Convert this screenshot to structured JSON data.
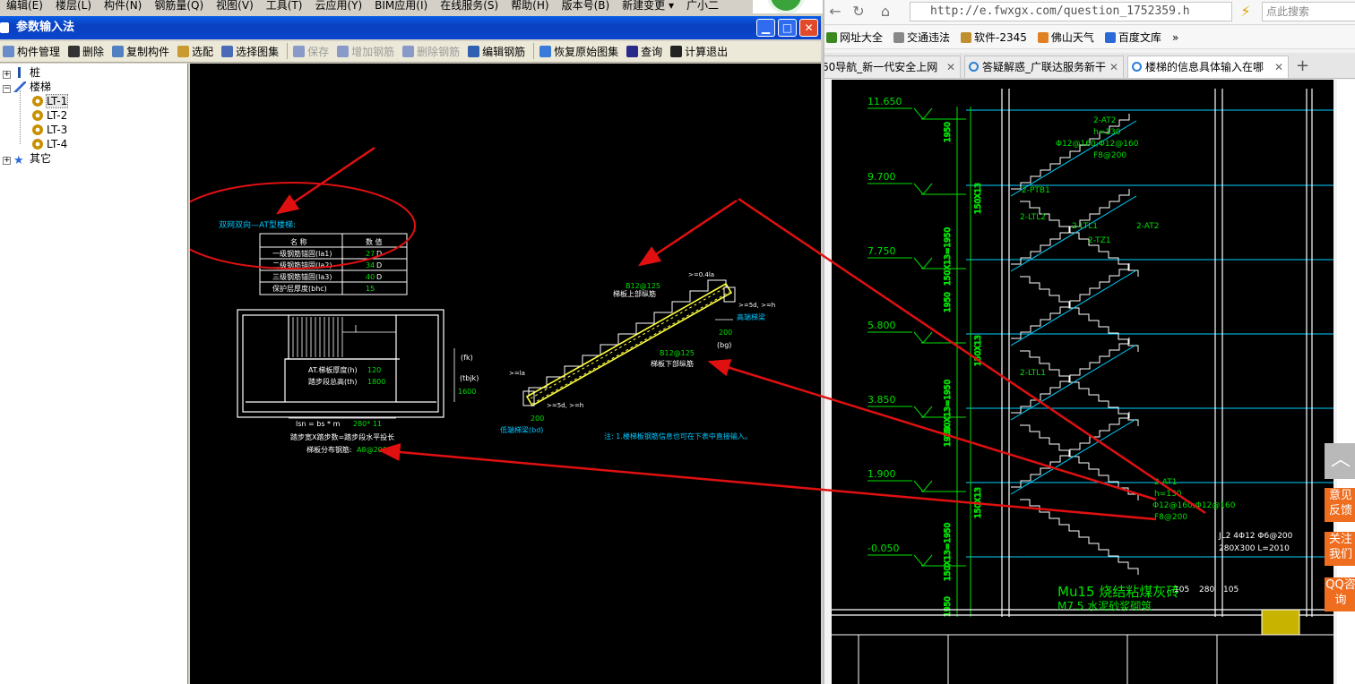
{
  "menubar": {
    "items": [
      "编辑(E)",
      "楼层(L)",
      "构件(N)",
      "钢筋量(Q)",
      "视图(V)",
      "工具(T)",
      "云应用(Y)",
      "BIM应用(I)",
      "在线服务(S)",
      "帮助(H)",
      "版本号(B)",
      "新建变更 ▾",
      "广小二"
    ]
  },
  "dialog": {
    "title": "参数输入法",
    "toolbar": [
      {
        "label": "构件管理",
        "enabled": true,
        "icon": "component-manager-icon"
      },
      {
        "label": "删除",
        "enabled": true,
        "icon": "delete-x-icon"
      },
      {
        "label": "复制构件",
        "enabled": true,
        "icon": "copy-icon"
      },
      {
        "label": "选配",
        "enabled": true,
        "icon": "select-icon"
      },
      {
        "label": "选择图集",
        "enabled": true,
        "icon": "atlas-icon"
      },
      {
        "label": "保存",
        "enabled": false,
        "icon": "save-icon"
      },
      {
        "label": "增加钢筋",
        "enabled": false,
        "icon": "add-rebar-icon"
      },
      {
        "label": "删除钢筋",
        "enabled": false,
        "icon": "delete-rebar-icon"
      },
      {
        "label": "编辑钢筋",
        "enabled": true,
        "icon": "edit-rebar-icon"
      },
      {
        "label": "恢复原始图集",
        "enabled": true,
        "icon": "restore-icon"
      },
      {
        "label": "查询",
        "enabled": true,
        "icon": "query-icon"
      },
      {
        "label": "计算退出",
        "enabled": true,
        "icon": "fx-icon"
      }
    ],
    "tree": {
      "pile": "桩",
      "stairs": "楼梯",
      "stair_items": [
        "LT-1",
        "LT-2",
        "LT-3",
        "LT-4"
      ],
      "selected": "LT-1",
      "other": "其它"
    },
    "cad": {
      "heading": "双网双向—AT型楼梯:",
      "table_head": [
        "名  称",
        "数  值"
      ],
      "table_rows": [
        {
          "name": "一级钢筋锚固(la1)",
          "value": "27",
          "unit": "D"
        },
        {
          "name": "二级钢筋锚固(la2)",
          "value": "34",
          "unit": "D"
        },
        {
          "name": "三级钢筋锚固(la3)",
          "value": "40",
          "unit": "D"
        },
        {
          "name": "保护层厚度(bhc)",
          "value": "15",
          "unit": ""
        }
      ],
      "plan_text_thickness": "AT.梯板厚度(h)",
      "plan_val_thickness": "120",
      "plan_text_height": "踏步段总高(th)",
      "plan_val_height": "1800",
      "label_fk": "(fk)",
      "label_tbjk": "(tbjk)",
      "val_1600": "1600",
      "formula_lsn": "lsn = bs * m",
      "formula_vals": "280* 11",
      "formula_note": "踏步宽X踏步数=踏步段水平投长",
      "dist_rebar_label": "梯板分布钢筋:",
      "dist_rebar_val": "A8@200",
      "top_rebar_val": "B12@125",
      "top_rebar_label": "梯板上部纵筋",
      "bot_rebar_val": "B12@125",
      "bot_rebar_label": "梯板下部纵筋",
      "high_beam_label": "高端梯梁",
      "low_beam_label": "低端梯梁(bd)",
      "dim_200_high": "200",
      "dim_bg": "(bg)",
      "dim_200_low": "200",
      "anchor_top": ">=0.4la",
      "anchor_high": ">=5d, >=h",
      "anchor_low": ">=5d, >=h",
      "anchor_la": ">=la",
      "note": "注: 1.楼梯板钢筋信息也可在下表中直接输入。"
    }
  },
  "browser": {
    "url": "http://e.fwxgx.com/question_1752359.h",
    "search_placeholder": "点此搜索",
    "bookmarks": [
      "网址大全",
      "交通违法",
      "软件-2345",
      "佛山天气",
      "百度文库"
    ],
    "tabs": [
      {
        "title": "60导航_新一代安全上网",
        "active": false
      },
      {
        "title": "答疑解惑_广联达服务新干",
        "active": false
      },
      {
        "title": "楼梯的信息具体输入在哪",
        "active": true
      }
    ],
    "drawing": {
      "levels": [
        "11.650",
        "9.700",
        "7.750",
        "5.800",
        "3.850",
        "1.900",
        "-0.050"
      ],
      "dims_vertical": [
        "1950",
        "150X13",
        "150X13=1950",
        "1950",
        "150X13",
        "150X13=1950",
        "1950",
        "150X13",
        "150X13=1950",
        "1950"
      ],
      "labels_at_top": [
        "2-AT2",
        "h=130",
        "Φ12@160;Φ12@160",
        "F8@200"
      ],
      "labels_mid": [
        "2-PTB1",
        "2-LTL2",
        "2-LTL1",
        "2-LTL1",
        "2-AT2",
        "2-TZ1"
      ],
      "labels_at1": [
        "2-AT1",
        "h=130",
        "Φ12@160;Φ12@160",
        "F8@200"
      ],
      "jl2": [
        "JL2  4Φ12 Φ6@200",
        "280X300  L=2010"
      ],
      "wall_note": "Mu15 烧结粘煤灰砖",
      "wall_note2": "M7.5 水泥砂浆砌筑",
      "dims_bottom": [
        "105",
        "280",
        "105"
      ]
    },
    "side_buttons": [
      "意见反馈",
      "关注我们",
      "QQ咨询"
    ]
  },
  "colors": {
    "arrow": "#e01010",
    "cad_green": "#00e000",
    "cad_cyan": "#00d0ff",
    "cad_yellow": "#ffff40",
    "side_orange": "#ef6d1f"
  }
}
